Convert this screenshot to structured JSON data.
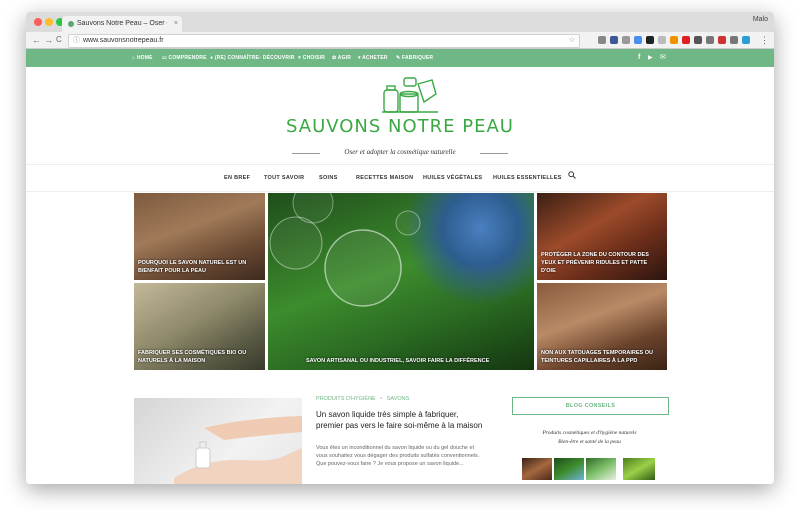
{
  "browser": {
    "tab_title": "Sauvons Notre Peau – Oser et",
    "tab_close": "×",
    "profile": "Malo",
    "url": "www.sauvonsnotrepeau.fr",
    "back": "←",
    "forward": "→",
    "reload": "C",
    "info_icon": "ⓘ",
    "star": "☆"
  },
  "topnav": {
    "items": [
      "HOME",
      "COMPRENDRE",
      "(RE) CONNAÎTRE",
      "DÉCOUVRIR",
      "CHOISIR",
      "AGIR",
      "ACHETER",
      "FABRIQUER"
    ],
    "icons": [
      "home-icon",
      "comment-icon",
      "check-circle-icon",
      "search-icon",
      "heart-icon",
      "gear-icon",
      "cart-icon",
      "wrench-icon"
    ],
    "social": [
      "f",
      "▶",
      "✉"
    ]
  },
  "header": {
    "logo_text": "SAUVONS NOTRE PEAU",
    "tagline": "Oser et adopter la cosmétique naturelle"
  },
  "mainnav": {
    "items": [
      "EN BREF",
      "TOUT SAVOIR",
      "SOINS",
      "RECETTES MAISON",
      "HUILES VÉGÉTALES",
      "HUILES ESSENTIELLES"
    ],
    "search_icon": "search-icon"
  },
  "featured": {
    "tiles": [
      {
        "caption": "POURQUOI LE SAVON NATUREL EST UN BIENFAIT POUR LA PEAU"
      },
      {
        "caption": "FABRIQUER SES COSMÉTIQUES BIO OU NATURELS À LA MAISON"
      },
      {
        "caption": "SAVON ARTISANAL OU INDUSTRIEL, SAVOIR FAIRE LA DIFFÉRENCE"
      },
      {
        "caption": "PROTÉGER LA ZONE DU CONTOUR DES YEUX ET PRÉVENIR RIDULES ET PATTE D'OIE"
      },
      {
        "caption": "NON AUX TATOUAGES TEMPORAIRES OU TEINTURES CAPILLAIRES À LA PPD"
      }
    ]
  },
  "post": {
    "category1": "PRODUITS D'HYGIÈNE",
    "separator": "•",
    "category2": "SAVONS",
    "title": "Un savon liquide très simple à fabriquer, premier pas vers le faire soi-même à la maison",
    "excerpt": "Vous êtes un inconditionnel du savon liquide ou du gel douche et vous souhaitez vous dégager des produits sulfatés conventionnels. Que pouvez-vous faire ? Je vous propose un savon liquide..."
  },
  "sidebar": {
    "box_title": "BLOG CONSEILS",
    "line1": "Produits cosmétiques et d'hygiène naturels",
    "line2": "Bien-être et santé de la peau"
  },
  "colors": {
    "accent": "#6fb784",
    "logo_green": "#3aa843"
  }
}
